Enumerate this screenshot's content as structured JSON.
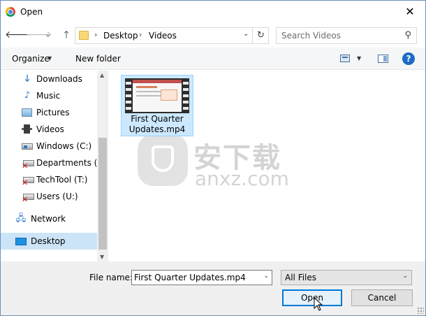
{
  "window": {
    "title": "Open",
    "close_glyph": "✕"
  },
  "nav": {
    "back_glyph": "🡐",
    "forward_glyph": "🡒",
    "recent_glyph": "⌄",
    "up_glyph": "🡑",
    "breadcrumb": [
      "Desktop",
      "Videos"
    ],
    "crumb_sep": "›",
    "dropdown_glyph": "⌄",
    "refresh_glyph": "↻",
    "search_placeholder": "Search Videos",
    "search_icon_glyph": "⚲"
  },
  "toolbar": {
    "organize_label": "Organize",
    "dropdown_glyph": "▼",
    "new_folder_label": "New folder",
    "help_glyph": "?"
  },
  "sidebar": {
    "items": [
      {
        "label": "Downloads",
        "icon": "downloads-icon",
        "glyph": "🡓"
      },
      {
        "label": "Music",
        "icon": "music-icon",
        "glyph": "♪"
      },
      {
        "label": "Pictures",
        "icon": "pictures-icon",
        "glyph": ""
      },
      {
        "label": "Videos",
        "icon": "videos-icon",
        "glyph": ""
      },
      {
        "label": "Windows (C:)",
        "icon": "windows-drive-icon",
        "glyph": ""
      },
      {
        "label": "Departments (N:",
        "icon": "disconnected-network-drive-icon",
        "glyph": "✕"
      },
      {
        "label": "TechTool (T:)",
        "icon": "disconnected-network-drive-icon",
        "glyph": "✕"
      },
      {
        "label": "Users (U:)",
        "icon": "disconnected-network-drive-icon",
        "glyph": "✕"
      },
      {
        "label": "Network",
        "icon": "network-icon",
        "glyph": "🖧"
      },
      {
        "label": "Desktop",
        "icon": "desktop-icon",
        "glyph": ""
      }
    ],
    "selected": "Desktop",
    "scroll_up_glyph": "▲",
    "scroll_down_glyph": "▼"
  },
  "files": [
    {
      "name": "First Quarter Updates.mp4",
      "icon": "video-thumbnail",
      "selected": true
    }
  ],
  "watermark": {
    "cn": "安下载",
    "en": "anxz.com"
  },
  "bottom": {
    "file_name_label": "File name:",
    "file_name_value": "First Quarter Updates.mp4",
    "file_type_value": "All Files",
    "dropdown_glyph": "⌄",
    "open_label": "Open",
    "cancel_label": "Cancel"
  },
  "colors": {
    "selection": "#cce8ff",
    "accent": "#0078d7",
    "help": "#1c6bc4"
  }
}
